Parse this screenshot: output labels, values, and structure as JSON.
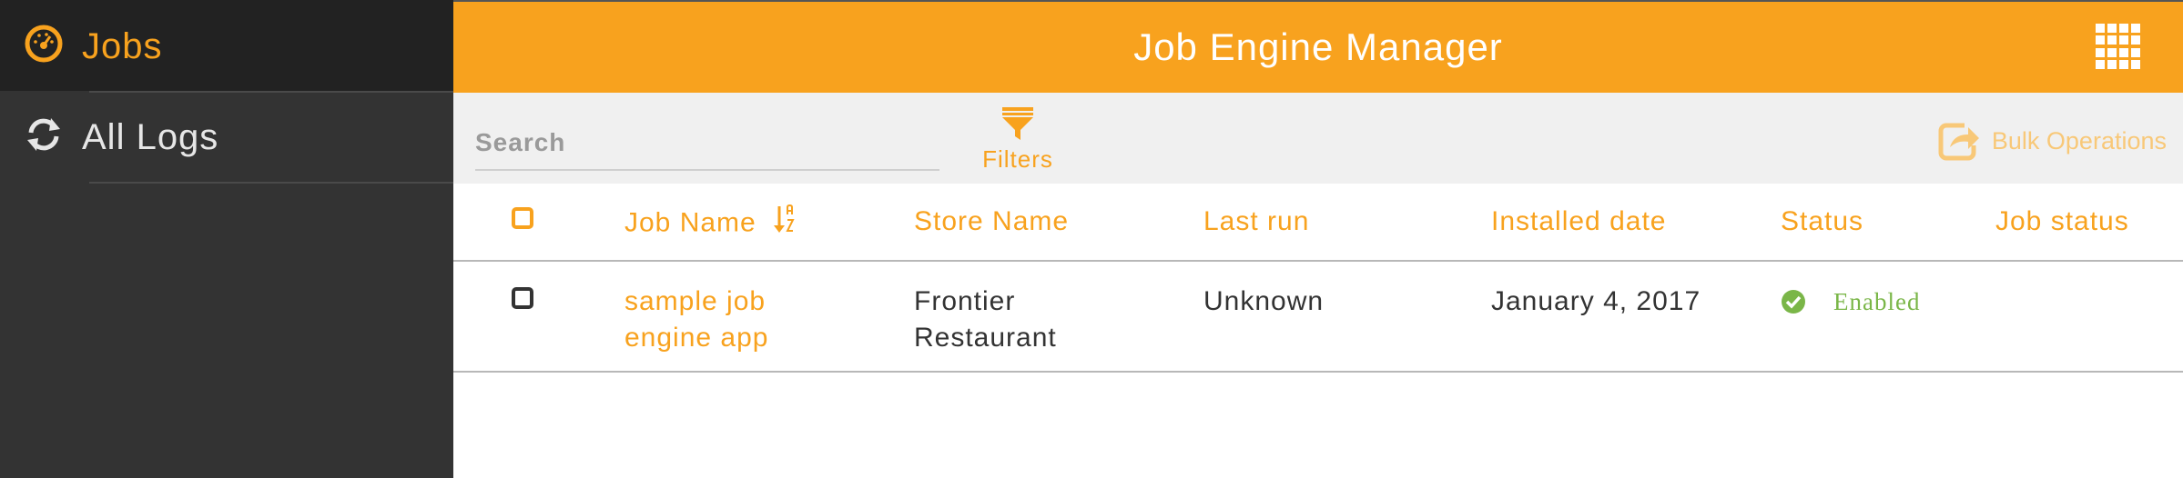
{
  "sidebar": {
    "items": [
      {
        "label": "Jobs",
        "icon": "dashboard-icon",
        "active": true
      },
      {
        "label": "All Logs",
        "icon": "refresh-icon",
        "active": false
      }
    ]
  },
  "header": {
    "title": "Job Engine Manager",
    "apps_icon": "apps-grid-icon"
  },
  "toolbar": {
    "search_placeholder": "Search",
    "filters_label": "Filters",
    "bulk_label": "Bulk Operations"
  },
  "table": {
    "columns": [
      "Job Name",
      "Store Name",
      "Last run",
      "Installed date",
      "Status",
      "Job status"
    ],
    "rows": [
      {
        "job_name_line1": "sample job",
        "job_name_line2": "engine app",
        "store_line1": "Frontier",
        "store_line2": "Restaurant",
        "last_run": "Unknown",
        "installed_date": "January 4, 2017",
        "status": "Enabled",
        "job_status": ""
      }
    ]
  },
  "colors": {
    "accent": "#f8a21e",
    "sidebar_bg": "#333333",
    "sidebar_active_bg": "#222222",
    "status_enabled": "#7ab648"
  }
}
